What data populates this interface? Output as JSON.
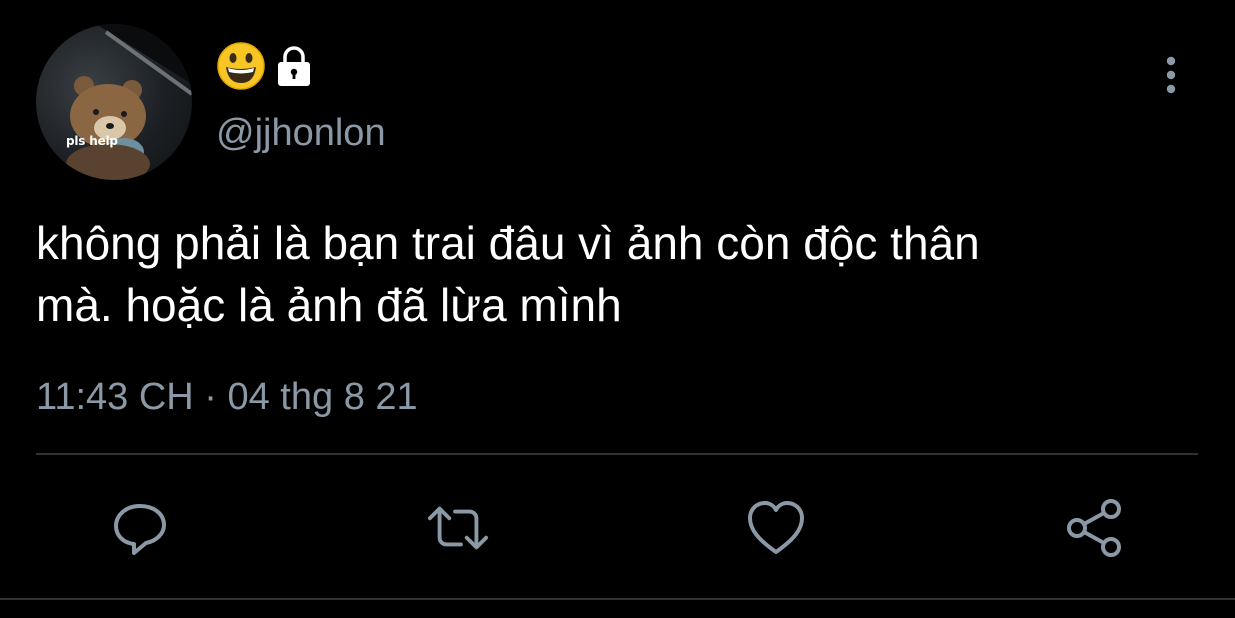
{
  "avatar": {
    "caption": "pls help"
  },
  "user": {
    "display_name_icons": [
      "grinning-face-emoji",
      "lock-icon"
    ],
    "handle": "@jjhonlon"
  },
  "tweet": {
    "lines": [
      "không phải là bạn trai đâu vì ảnh còn độc thân",
      "mà. hoặc là ảnh đã lừa mình"
    ],
    "timestamp": "11:43 CH · 04 thg 8 21"
  },
  "actions": {
    "icons": [
      "reply-icon",
      "retweet-icon",
      "like-icon",
      "share-icon"
    ]
  },
  "colors": {
    "background": "#000000",
    "text": "#ffffff",
    "secondary": "#8b98a5",
    "divider": "#2f3336"
  }
}
